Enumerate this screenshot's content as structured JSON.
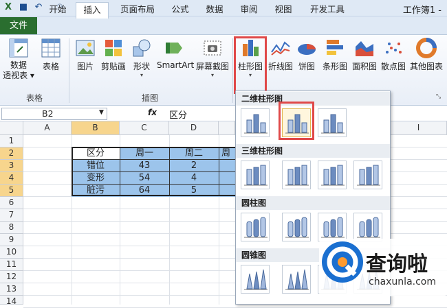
{
  "titlebar": {
    "title": "工作簿1 -"
  },
  "tabs": [
    "开始",
    "插入",
    "页面布局",
    "公式",
    "数据",
    "审阅",
    "视图",
    "开发工具"
  ],
  "file_tab": "文件",
  "ribbon": {
    "buttons": [
      {
        "label": "数据\n透视表",
        "icon": "pivot-table-icon"
      },
      {
        "label": "表格",
        "icon": "table-icon"
      },
      {
        "label": "图片",
        "icon": "picture-icon"
      },
      {
        "label": "剪贴画",
        "icon": "clipart-icon"
      },
      {
        "label": "形状",
        "icon": "shapes-icon"
      },
      {
        "label": "SmartArt",
        "icon": "smartart-icon"
      },
      {
        "label": "屏幕截图",
        "icon": "screenshot-icon"
      },
      {
        "label": "柱形图",
        "icon": "column-chart-icon"
      },
      {
        "label": "折线图",
        "icon": "line-chart-icon"
      },
      {
        "label": "饼图",
        "icon": "pie-chart-icon"
      },
      {
        "label": "条形图",
        "icon": "bar-chart-icon"
      },
      {
        "label": "面积图",
        "icon": "area-chart-icon"
      },
      {
        "label": "散点图",
        "icon": "scatter-chart-icon"
      },
      {
        "label": "其他图表",
        "icon": "other-chart-icon"
      }
    ],
    "groups": [
      "表格",
      "插图"
    ]
  },
  "formula": {
    "namebox": "B2",
    "fx": "fx",
    "value": "区分"
  },
  "columns": [
    "A",
    "B",
    "C",
    "D",
    "I"
  ],
  "rows": [
    "1",
    "2",
    "3",
    "4",
    "5",
    "6",
    "7",
    "8",
    "9",
    "10",
    "11",
    "12",
    "13",
    "14"
  ],
  "table": [
    [
      "区分",
      "周一",
      "周二",
      "周"
    ],
    [
      "错位",
      "43",
      "2",
      ""
    ],
    [
      "变形",
      "54",
      "4",
      ""
    ],
    [
      "脏污",
      "64",
      "5",
      ""
    ]
  ],
  "dropdown": {
    "sections": [
      "二维柱形图",
      "三维柱形图",
      "圆柱图",
      "圆锥图"
    ]
  },
  "watermark": {
    "text": "查询啦",
    "url": "chaxunla.com"
  },
  "colors": {
    "file_tab": "#2a6e2f",
    "selected_header": "#f7d58d",
    "table_fill": "#9cc4eb",
    "highlight": "#e04848"
  }
}
